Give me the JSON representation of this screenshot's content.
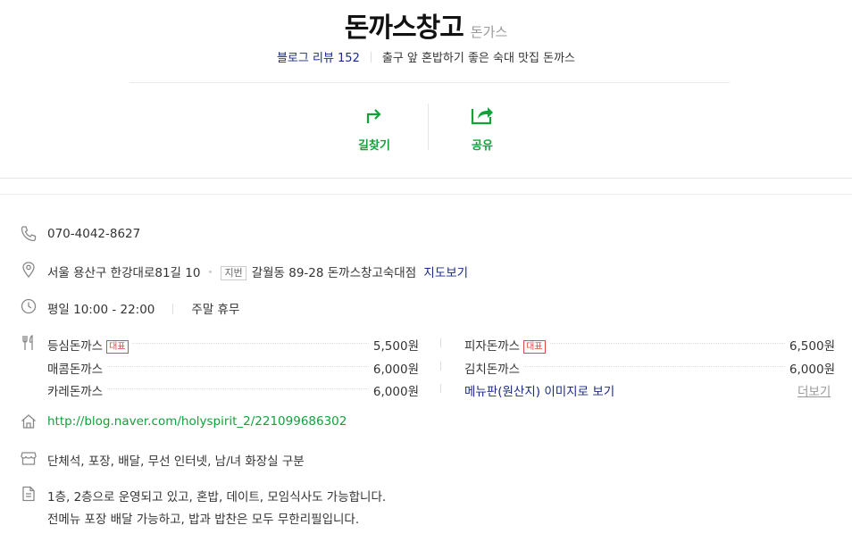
{
  "header": {
    "title": "돈까스창고",
    "category": "돈가스",
    "blog_review": "블로그 리뷰 152",
    "description": "출구 앞 혼밥하기 좋은 숙대 맛집 돈까스"
  },
  "actions": {
    "directions_label": "길찾기",
    "share_label": "공유"
  },
  "info": {
    "phone": "070-4042-8627",
    "address": "서울 용산구 한강대로81길 10",
    "jibun_tag": "지번",
    "jibun_address": "갈월동 89-28 돈까스창고숙대점",
    "map_link": "지도보기",
    "hours": "평일 10:00 - 22:00",
    "holiday": "주말 휴무",
    "website": "http://blog.naver.com/holyspirit_2/221099686302",
    "facilities": "단체석, 포장, 배달, 무선 인터넷, 남/녀 화장실 구분",
    "description_line1": "1층, 2층으로 운영되고 있고, 혼밥, 데이트, 모임식사도 가능합니다.",
    "description_line2": "전메뉴 포장 배달 가능하고, 밥과 밥찬은 모두 무한리필입니다."
  },
  "menu": {
    "rep_badge": "대표",
    "left": [
      {
        "name": "등심돈까스",
        "price": "5,500원",
        "rep": true
      },
      {
        "name": "매콤돈까스",
        "price": "6,000원",
        "rep": false
      },
      {
        "name": "카레돈까스",
        "price": "6,000원",
        "rep": false
      }
    ],
    "right": [
      {
        "name": "피자돈까스",
        "price": "6,500원",
        "rep": true
      },
      {
        "name": "김치돈까스",
        "price": "6,000원",
        "rep": false
      }
    ],
    "menu_image_link": "메뉴판(원산지) 이미지로 보기",
    "more_link": "더보기"
  },
  "colors": {
    "green": "#10a33a",
    "blue_link": "#1a2a8a",
    "rep_red": "#e04848"
  }
}
